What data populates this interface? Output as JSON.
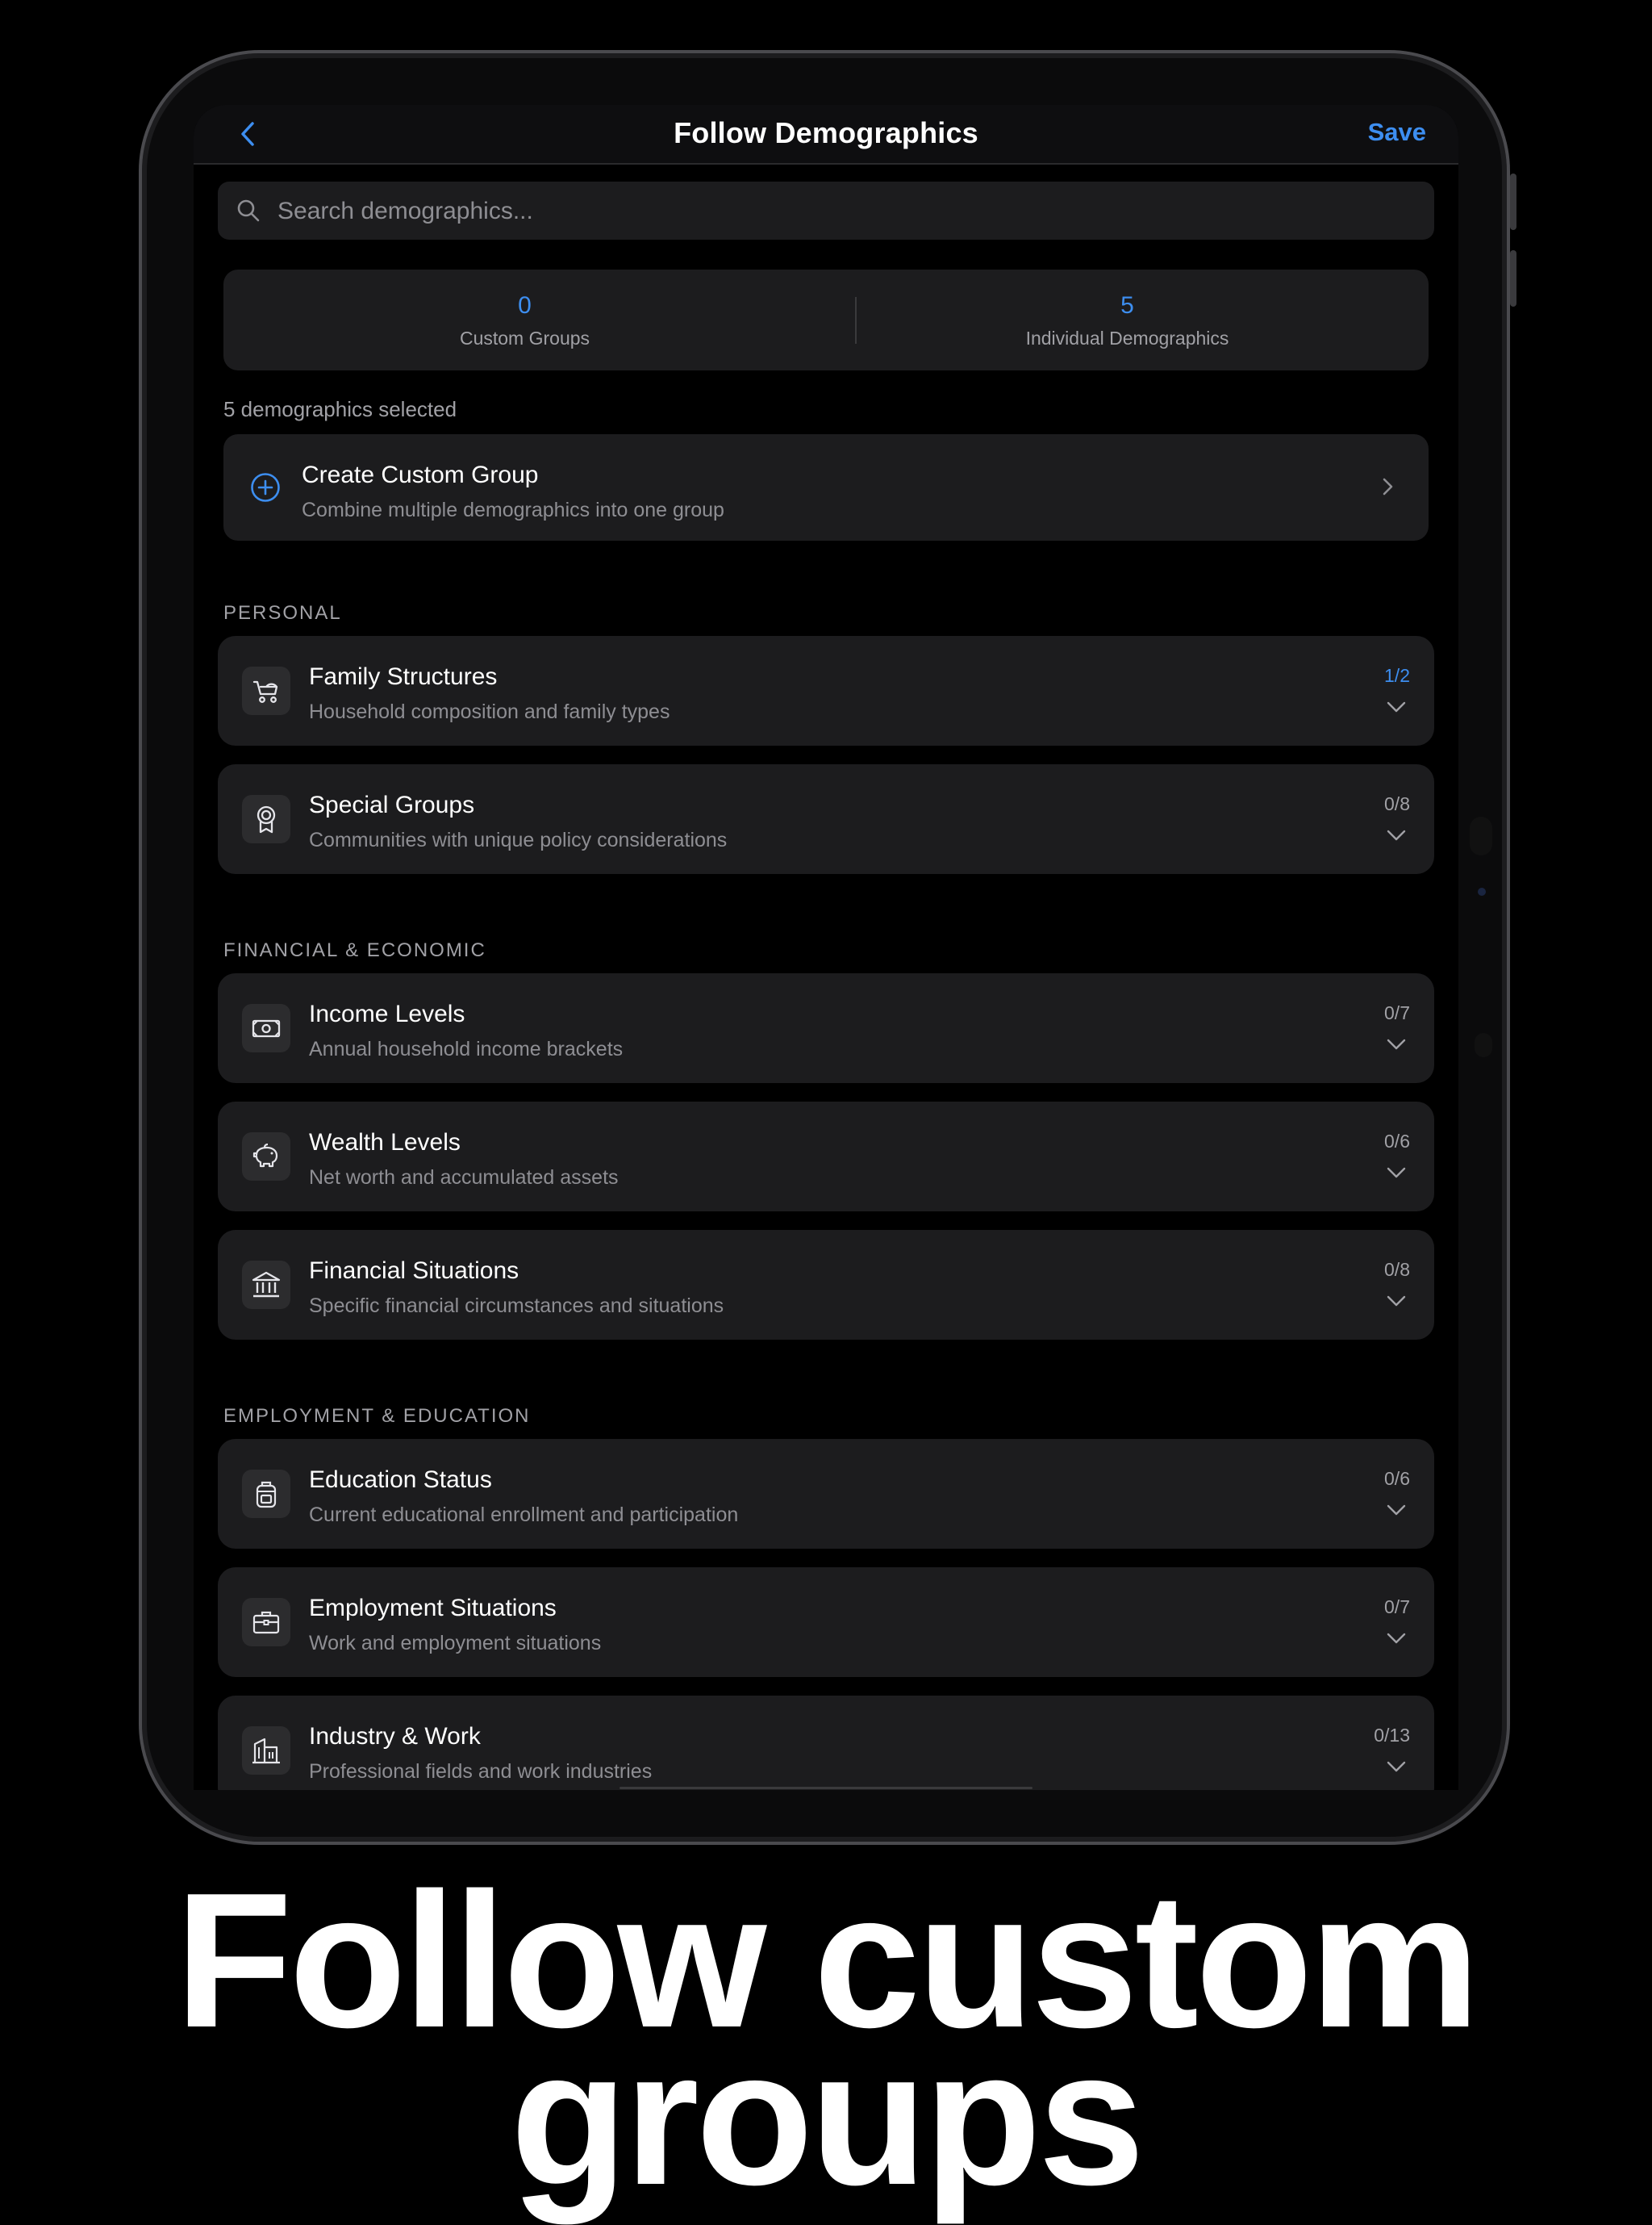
{
  "nav": {
    "title": "Follow Demographics",
    "save_label": "Save"
  },
  "search": {
    "placeholder": "Search demographics..."
  },
  "stats": [
    {
      "value": "0",
      "label": "Custom Groups"
    },
    {
      "value": "5",
      "label": "Individual Demographics"
    }
  ],
  "selected_count": "5 demographics selected",
  "create_group": {
    "title": "Create Custom Group",
    "subtitle": "Combine multiple demographics into one group"
  },
  "sections": [
    {
      "header": "PERSONAL"
    },
    {
      "header": "FINANCIAL & ECONOMIC"
    },
    {
      "header": "EMPLOYMENT & EDUCATION"
    }
  ],
  "categories": [
    {
      "title": "Family Structures",
      "subtitle": "Household composition and family types",
      "count": "1/2",
      "icon": "stroller-icon",
      "active": true
    },
    {
      "title": "Special Groups",
      "subtitle": "Communities with unique policy considerations",
      "count": "0/8",
      "icon": "award-ribbon-icon"
    },
    {
      "title": "Income Levels",
      "subtitle": "Annual household income brackets",
      "count": "0/7",
      "icon": "banknote-icon"
    },
    {
      "title": "Wealth Levels",
      "subtitle": "Net worth and accumulated assets",
      "count": "0/6",
      "icon": "piggy-bank-icon"
    },
    {
      "title": "Financial Situations",
      "subtitle": "Specific financial circumstances and situations",
      "count": "0/8",
      "icon": "bank-building-icon"
    },
    {
      "title": "Education Status",
      "subtitle": "Current educational enrollment and participation",
      "count": "0/6",
      "icon": "backpack-icon"
    },
    {
      "title": "Employment Situations",
      "subtitle": "Work and employment situations",
      "count": "0/7",
      "icon": "briefcase-icon"
    },
    {
      "title": "Industry & Work",
      "subtitle": "Professional fields and work industries",
      "count": "0/13",
      "icon": "office-buildings-icon"
    }
  ],
  "promo": {
    "line1": "Follow custom",
    "line2": "groups"
  },
  "colors": {
    "accent": "#3d8ef0",
    "card": "#1c1c1e",
    "background": "#000000"
  }
}
